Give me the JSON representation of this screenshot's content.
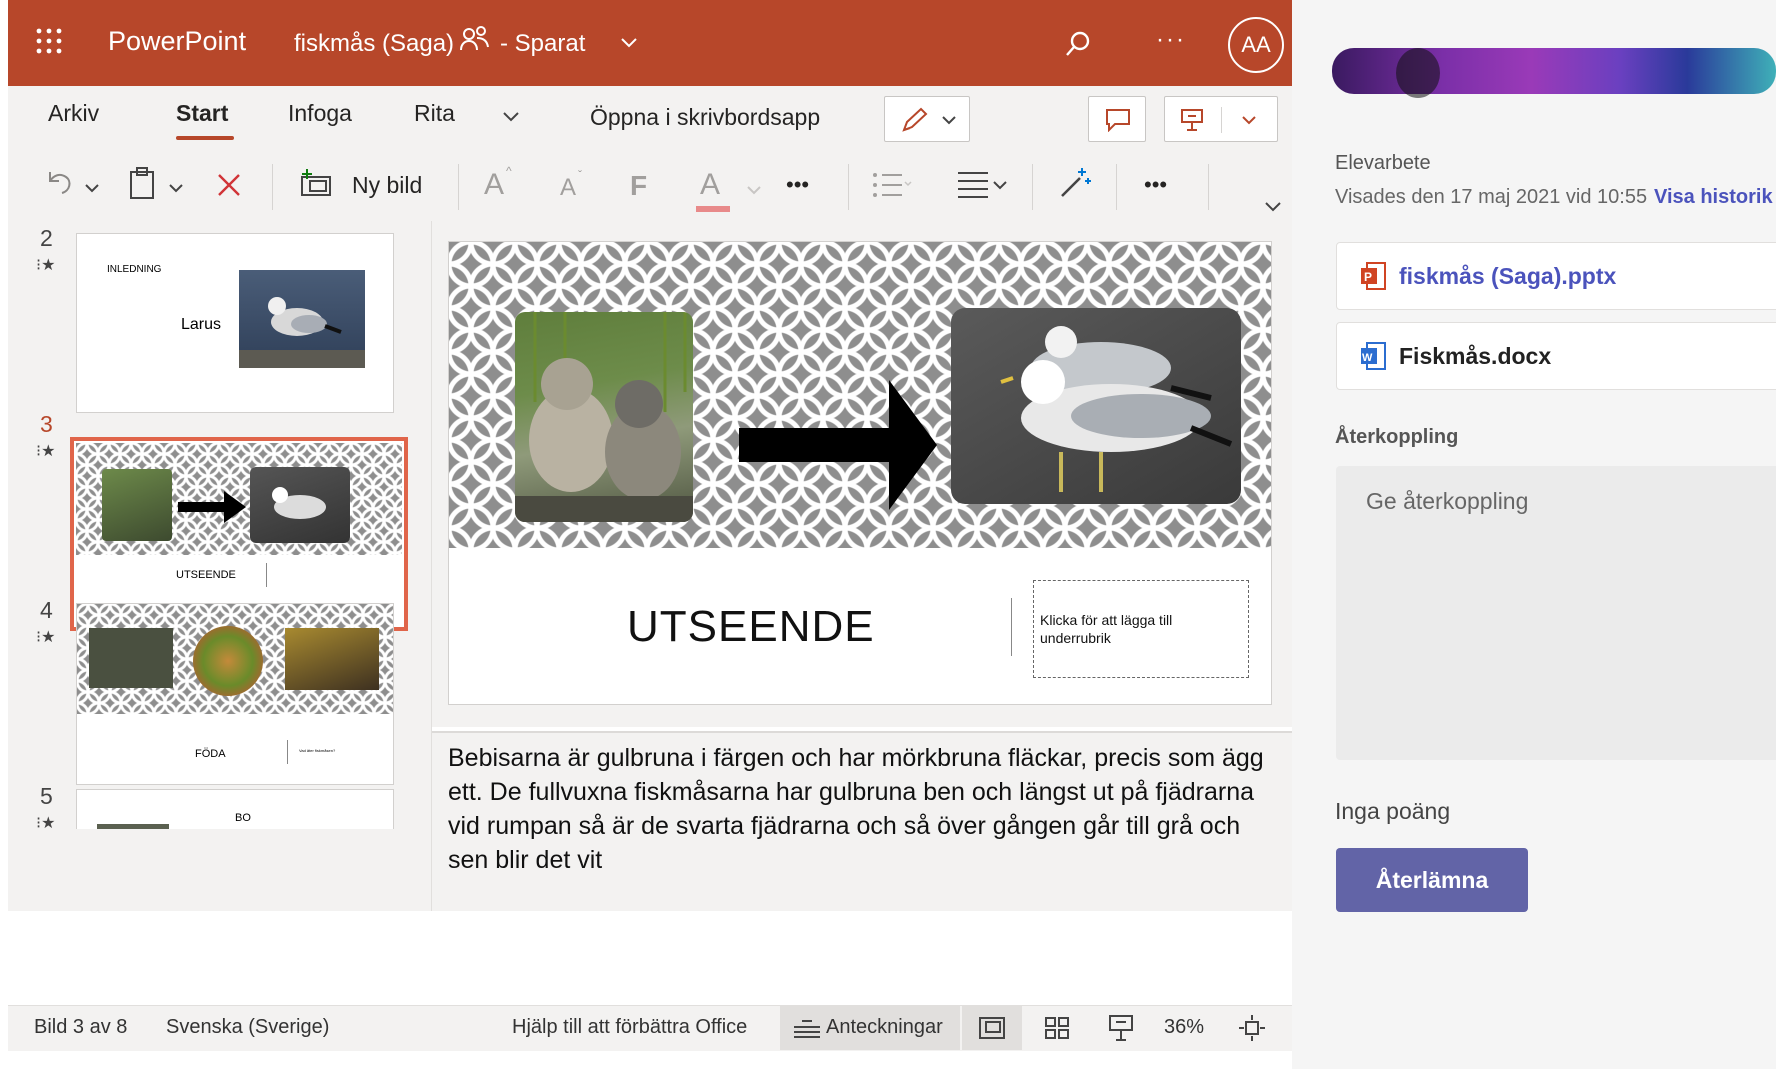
{
  "header": {
    "app_name": "PowerPoint",
    "file_title": "fiskmås (Saga)",
    "save_status": "- Sparat",
    "avatar_initials": "AA",
    "accent_color": "#b7472a"
  },
  "ribbon": {
    "tabs": [
      "Arkiv",
      "Start",
      "Infoga",
      "Rita"
    ],
    "active_tab": "Start",
    "open_desktop": "Öppna i skrivbordsapp",
    "new_slide": "Ny bild",
    "font_bold": "F",
    "font_grow": "A",
    "font_shrink": "A",
    "font_color": "A",
    "more": "•••"
  },
  "thumbnails": [
    {
      "number": "2",
      "title": "INLEDNING",
      "subtitle": "Larus"
    },
    {
      "number": "3",
      "title": "UTSEENDE",
      "selected": true
    },
    {
      "number": "4",
      "title": "FÖDA",
      "subtitle": "Vad äter fiskmåsen?"
    },
    {
      "number": "5",
      "title": "BO"
    }
  ],
  "slide": {
    "title": "UTSEENDE",
    "subtitle_placeholder": "Klicka för att lägga till underrubrik"
  },
  "notes": {
    "text": "Bebisarna är gulbruna i färgen och har mörkbruna fläckar, precis som ägg ett. De fullvuxna fiskmåsarna har gulbruna ben och längst ut på fjädrarna vid rumpan så är de svarta fjädrarna och så över gången går till grå och sen blir det vit"
  },
  "status": {
    "slide_pos": "Bild 3 av 8",
    "language": "Svenska (Sverige)",
    "help": "Hjälp till att förbättra Office",
    "notes_btn": "Anteckningar",
    "zoom": "36%"
  },
  "panel": {
    "section_label": "Elevarbete",
    "viewed": "Visades den 17 maj 2021 vid 10:55",
    "history_link": "Visa historik",
    "files": [
      {
        "name": "fiskmås (Saga).pptx",
        "type": "pptx"
      },
      {
        "name": "Fiskmås.docx",
        "type": "docx"
      }
    ],
    "feedback_label": "Återkoppling",
    "feedback_placeholder": "Ge återkoppling",
    "points": "Inga poäng",
    "return_button": "Återlämna",
    "button_color": "#6264a7"
  }
}
